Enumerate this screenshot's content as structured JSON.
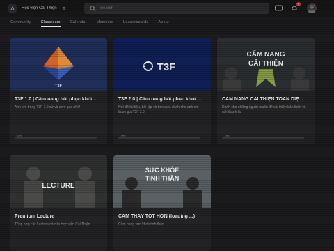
{
  "header": {
    "group_name": "Học viện Cải Thiện",
    "search_placeholder": "Search",
    "notification_count": "1"
  },
  "tabs": [
    {
      "label": "Community"
    },
    {
      "label": "Classroom"
    },
    {
      "label": "Calendar"
    },
    {
      "label": "Members"
    },
    {
      "label": "Leaderboards"
    },
    {
      "label": "About"
    }
  ],
  "courses": [
    {
      "title": "T3F 1.0 | Cẩm nang hồi phục khỏi ...",
      "description": "Anh em trong T3F 1.0 cứ và xem qua nhé!",
      "thumb_text": "T3F",
      "progress_label": "0%",
      "progress": 0
    },
    {
      "title": "T3F 2.0 | Cẩm nang hồi phục khỏi ...",
      "description": "Nơi để tài liệu, bài tập và bonuses dành cho anh em tham gia T3F 2.0",
      "thumb_text": "T3F",
      "progress_label": "0%",
      "progress": 0
    },
    {
      "title": "CẨM NANG CẢI THIỆN TOÀN DIỆ...",
      "description": "Dành cho những người muốn để cải thiện bản thân và mở thành tài",
      "thumb_text_1": "CẨM NANG",
      "thumb_text_2": "CẢI THIỆN",
      "progress_label": "0%",
      "progress": 0
    },
    {
      "title": "Premium Lecture",
      "description": "Tổng hợp các Lecture có của Học viện Cải Thiện",
      "thumb_text": "LECTURE"
    },
    {
      "title": "CẢM THẤY TỐT HƠN (loading ...)",
      "description": "Cẩm nang sức khỏe tinh thần",
      "thumb_text_1": "SỨC KHỎE",
      "thumb_text_2": "TINH THẦN"
    }
  ]
}
